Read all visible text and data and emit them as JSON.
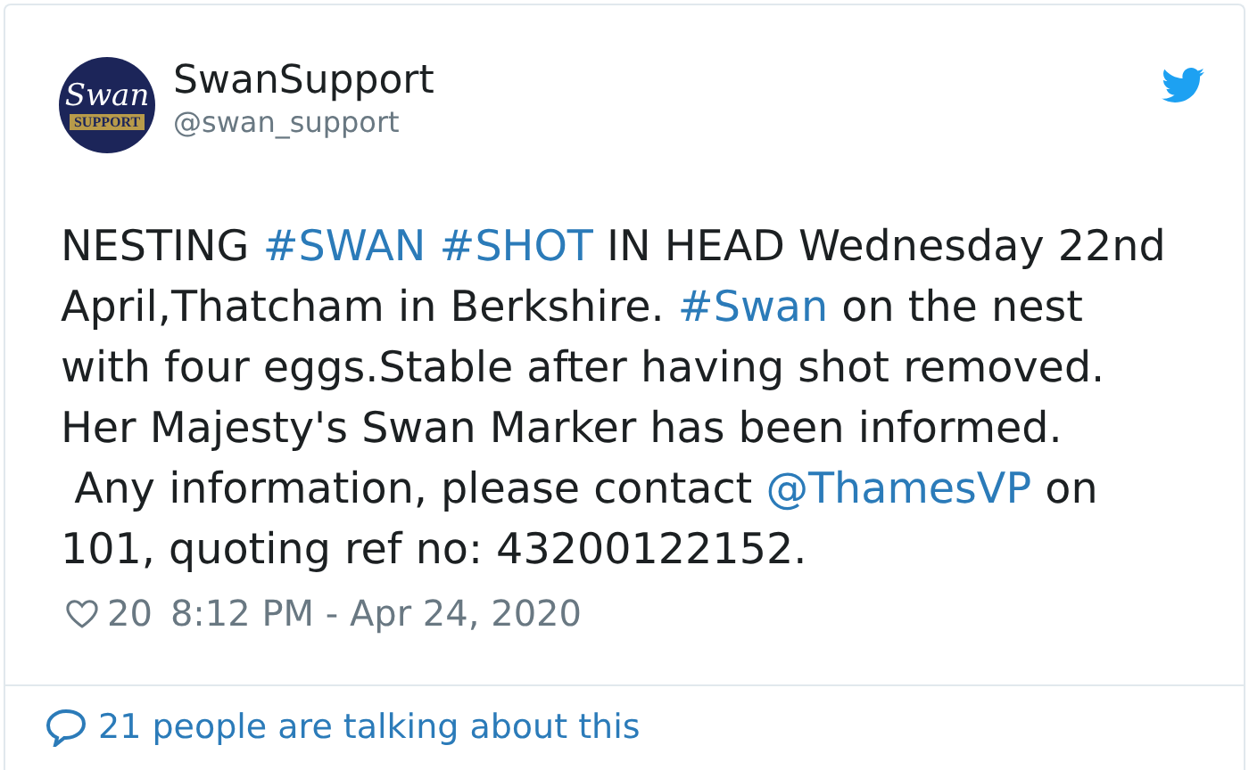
{
  "author": {
    "name": "SwanSupport",
    "handle": "@swan_support",
    "avatar": {
      "script": "Swan",
      "band": "SUPPORT"
    }
  },
  "text_lines": [
    [
      {
        "kind": "text",
        "text": "NESTING "
      },
      {
        "kind": "link",
        "text": "#SWAN"
      },
      {
        "kind": "link",
        "text": "#SHOT"
      },
      {
        "kind": "text",
        "text": " IN HEAD Wednesday 22nd"
      }
    ],
    [
      {
        "kind": "text",
        "text": "April,Thatcham in Berkshire. "
      },
      {
        "kind": "link",
        "text": "#Swan"
      },
      {
        "kind": "text",
        "text": " on the nest"
      }
    ],
    [
      {
        "kind": "text",
        "text": "with four eggs.Stable after having shot removed."
      }
    ],
    [
      {
        "kind": "text",
        "text": "Her Majesty's Swan Marker has been informed."
      }
    ],
    [
      {
        "kind": "text",
        "text": " Any information, please contact "
      },
      {
        "kind": "link",
        "text": "@ThamesVP"
      },
      {
        "kind": "text",
        "text": " on"
      }
    ],
    [
      {
        "kind": "text",
        "text": "101, quoting ref no: 43200122152."
      }
    ]
  ],
  "likes": "20",
  "timestamp": "8:12 PM - Apr 24, 2020",
  "conversation": "21 people are talking about this"
}
